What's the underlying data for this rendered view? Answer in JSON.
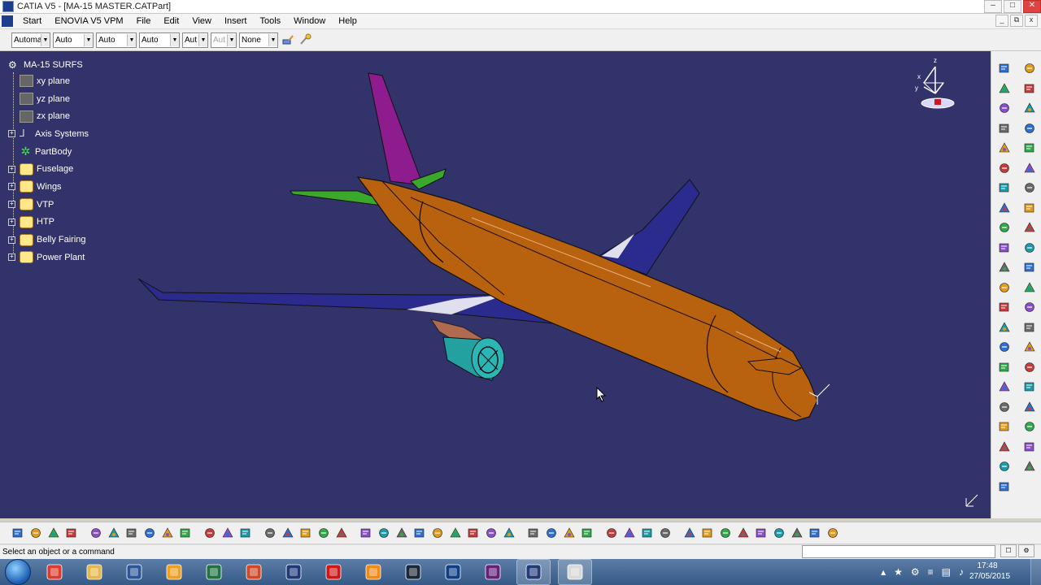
{
  "window": {
    "title": "CATIA V5 - [MA-15 MASTER.CATPart]",
    "controls": [
      "–",
      "□",
      "✕"
    ],
    "mdi_controls": [
      "_",
      "⧉",
      "x"
    ]
  },
  "menu": {
    "items": [
      "Start",
      "ENOVIA V5 VPM",
      "File",
      "Edit",
      "View",
      "Insert",
      "Tools",
      "Window",
      "Help"
    ]
  },
  "properties_toolbar": {
    "combos": [
      {
        "value": "Automa",
        "disabled": false
      },
      {
        "value": "Auto",
        "disabled": false
      },
      {
        "value": "Auto",
        "disabled": false
      },
      {
        "value": "Auto",
        "disabled": false
      },
      {
        "value": "Aut",
        "disabled": false
      },
      {
        "value": "Aut",
        "disabled": true
      },
      {
        "value": "None",
        "disabled": false
      }
    ],
    "tools": [
      "painter-icon",
      "format-brush-icon"
    ]
  },
  "viewport": {
    "background": "#33336b",
    "tree": {
      "root": "MA-15 SURFS",
      "items": [
        {
          "label": "xy plane",
          "icon": "plane-icon",
          "expandable": false
        },
        {
          "label": "yz plane",
          "icon": "plane-icon",
          "expandable": false
        },
        {
          "label": "zx plane",
          "icon": "plane-icon",
          "expandable": false
        },
        {
          "label": "Axis Systems",
          "icon": "axis-system-icon",
          "expandable": true
        },
        {
          "label": "PartBody",
          "icon": "part-body-icon",
          "expandable": false
        },
        {
          "label": "Fuselage",
          "icon": "geometrical-set-icon",
          "expandable": true
        },
        {
          "label": "Wings",
          "icon": "geometrical-set-icon",
          "expandable": true
        },
        {
          "label": "VTP",
          "icon": "geometrical-set-icon",
          "expandable": true
        },
        {
          "label": "HTP",
          "icon": "geometrical-set-icon",
          "expandable": true
        },
        {
          "label": "Belly Fairing",
          "icon": "geometrical-set-icon",
          "expandable": true
        },
        {
          "label": "Power Plant",
          "icon": "geometrical-set-icon",
          "expandable": true
        }
      ]
    },
    "model_colors": {
      "fuselage": "#b8610f",
      "wings": "#2b2b8e",
      "vtp": "#8e1c8e",
      "htp": "#3aa82a",
      "belly_fairing": "#a8a818",
      "engine": "#23a0a0",
      "pylon": "#b06a50"
    }
  },
  "right_toolbar": {
    "tools": [
      "sketcher-icon",
      "point-icon",
      "line-icon",
      "plane-icon",
      "projection-icon",
      "intersection-icon",
      "circle-icon",
      "spline-icon",
      "helix-icon",
      "extrude-icon",
      "revolve-icon",
      "sphere-icon",
      "sweep-icon",
      "fill-icon",
      "multisection-icon",
      "blend-icon",
      "join-icon",
      "healing-icon",
      "split-icon",
      "trim-icon",
      "boundary-icon",
      "extract-icon",
      "fillet-icon",
      "translate-icon",
      "rotate-icon",
      "symmetry-icon",
      "scaling-icon",
      "affinity-icon",
      "axis-to-axis-icon",
      "extrapolate-icon",
      "invert-orientation-icon",
      "near-icon",
      "repetition-icon",
      "measure-icon",
      "apply-material-icon",
      "part-body-icon",
      "geometrical-set-icon",
      "ordered-set-icon",
      "datum-icon",
      "knowledge-icon",
      "formula-icon",
      "hide-show-icon",
      "swap-icon"
    ]
  },
  "bottom_toolbar": {
    "tools": [
      "new-icon",
      "open-icon",
      "save-icon",
      "print-icon",
      "cut-icon",
      "copy-icon",
      "paste-icon",
      "undo-icon",
      "redo-icon",
      "whats-this-icon",
      "formula-icon",
      "comment-icon",
      "scan-icon",
      "table-icon",
      "knowledge-icon",
      "macro-icon",
      "reaction-icon",
      "fly-mode-icon",
      "fit-all-icon",
      "pan-icon",
      "rotate-icon",
      "zoom-in-icon",
      "zoom-out-icon",
      "normal-view-icon",
      "multi-view-icon",
      "iso-view-icon",
      "shading-icon",
      "hide-show-icon",
      "swap-visible-icon",
      "update-icon",
      "render-icon",
      "measure-icon",
      "apply-material-icon",
      "capture-icon",
      "hybrid-design-icon",
      "grid-icon",
      "axis-icon",
      "tree-icon",
      "snap-icon",
      "3d-compass-icon",
      "sketch-analysis-icon",
      "constraint-icon",
      "material-icon",
      "catia-logo-icon"
    ]
  },
  "status": {
    "message": "Select an object or a command",
    "command_value": "",
    "buttons": [
      "☐",
      "⚙"
    ]
  },
  "taskbar": {
    "apps": [
      {
        "name": "chrome-app",
        "color": "#dd3b2e",
        "active": false
      },
      {
        "name": "file-explorer-app",
        "color": "#e6b84a",
        "active": false
      },
      {
        "name": "word-app",
        "color": "#2b579a",
        "active": false
      },
      {
        "name": "outlook-app",
        "color": "#f0a020",
        "active": false
      },
      {
        "name": "excel-app",
        "color": "#217346",
        "active": false
      },
      {
        "name": "powerpoint-app",
        "color": "#d24726",
        "active": false
      },
      {
        "name": "catia-app",
        "color": "#1e3a7a",
        "active": false
      },
      {
        "name": "acrobat-app",
        "color": "#d01616",
        "active": false
      },
      {
        "name": "vlc-app",
        "color": "#f28a16",
        "active": false
      },
      {
        "name": "steam-app",
        "color": "#1b2838",
        "active": false
      },
      {
        "name": "media-app",
        "color": "#0f3f86",
        "active": false
      },
      {
        "name": "visual-studio-app",
        "color": "#68217a",
        "active": false
      },
      {
        "name": "catia-active-app",
        "color": "#243b7a",
        "active": true
      },
      {
        "name": "window-app",
        "color": "#d9d9d9",
        "active": true
      }
    ],
    "tray_icons": [
      "▴",
      "★",
      "⚙",
      "≡",
      "▤",
      "♪"
    ],
    "time": "17:48",
    "date": "27/05/2015"
  }
}
